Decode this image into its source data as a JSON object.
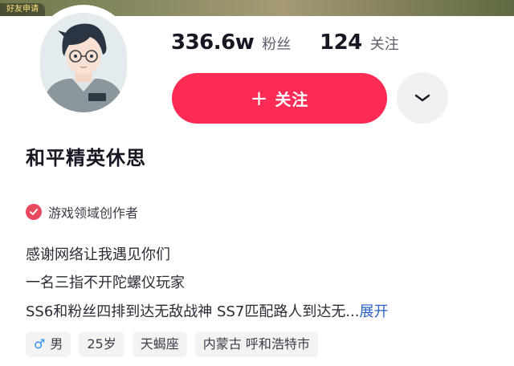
{
  "banner": {
    "badge": "好友申请"
  },
  "stats": {
    "followers_value": "336.6w",
    "followers_label": "粉丝",
    "following_value": "124",
    "following_label": "关注"
  },
  "follow_button": {
    "label": "关注",
    "icon": "plus-icon"
  },
  "more_button": {
    "icon": "chevron-down-icon"
  },
  "profile": {
    "name": "和平精英休思"
  },
  "verification": {
    "icon": "verified-check-icon",
    "text": "游戏领域创作者"
  },
  "bio": {
    "line1": "感谢网络让我遇见你们",
    "line2": "一名三指不开陀螺仪玩家",
    "line3": "SS6和粉丝四排到达无敌战神 SS7匹配路人到达无...",
    "expand": "展开"
  },
  "tags": {
    "gender": "男",
    "gender_icon": "male-icon",
    "age": "25岁",
    "zodiac": "天蝎座",
    "location": "内蒙古 呼和浩特市"
  },
  "colors": {
    "accent": "#fe2c55",
    "verify": "#e8495f",
    "link": "#2b61c4",
    "male": "#2b8ef0"
  }
}
